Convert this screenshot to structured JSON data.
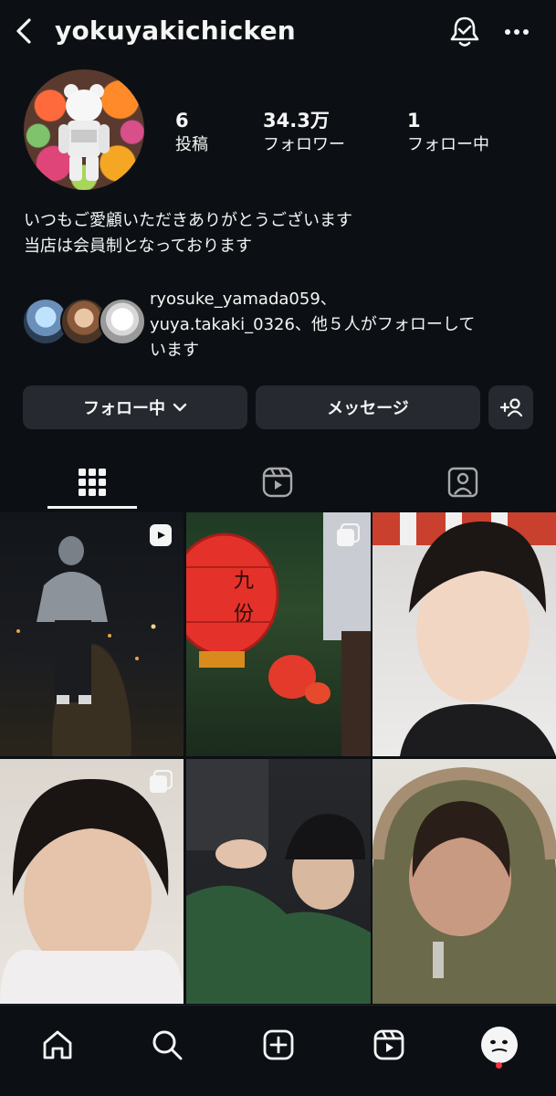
{
  "header": {
    "username": "yokuyakichicken"
  },
  "stats": [
    {
      "number": "6",
      "label": "投稿"
    },
    {
      "number": "34.3万",
      "label": "フォロワー"
    },
    {
      "number": "1",
      "label": "フォロー中"
    }
  ],
  "bio": {
    "line1": "いつもご愛顧いただきありがとうございます",
    "line2": "当店は会員制となっております"
  },
  "followed_by": {
    "line1": "ryosuke_yamada059、",
    "line2": "yuya.takaki_0326、他５人がフォローして",
    "line3": "います"
  },
  "actions": {
    "following_label": "フォロー中",
    "message_label": "メッセージ"
  },
  "colors": {
    "background": "#0c1014",
    "button": "#262a30",
    "text": "#f5f5f5",
    "notification_dot": "#ff3040"
  },
  "icons": {
    "back": "chevron-left-icon",
    "notifications": "bell-check-icon",
    "more": "more-horizontal-icon",
    "suggest": "add-person-icon",
    "grid": "grid-icon",
    "reels": "reels-icon",
    "tagged": "tagged-person-icon",
    "home": "home-icon",
    "search": "search-icon",
    "create": "plus-square-icon"
  }
}
